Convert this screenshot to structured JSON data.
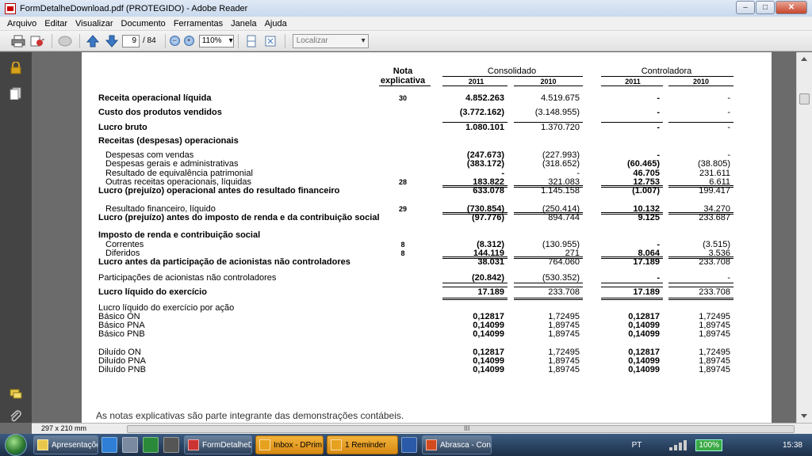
{
  "window": {
    "title": "FormDetalheDownload.pdf (PROTEGIDO) - Adobe Reader",
    "controls": [
      "–",
      "□",
      "✕"
    ]
  },
  "menu": [
    "Arquivo",
    "Editar",
    "Visualizar",
    "Documento",
    "Ferramentas",
    "Janela",
    "Ajuda"
  ],
  "toolbar": {
    "page_current": "9",
    "page_total": "/ 84",
    "zoom": "110%",
    "find_placeholder": "Localizar"
  },
  "statement": {
    "header": {
      "nota_line1": "Nota",
      "nota_line2": "explicativa",
      "consolidado": "Consolidado",
      "controladora": "Controladora",
      "years": [
        "2011",
        "2010",
        "2011",
        "2010"
      ]
    },
    "rows": [
      {
        "label": "Receita operacional líquida",
        "note": "30",
        "c2011": "4.852.263",
        "c2010": "4.519.675",
        "p2011": "-",
        "p2010": "-"
      },
      {
        "label": "Custo dos produtos vendidos",
        "note": "",
        "c2011": "(3.772.162)",
        "c2010": "(3.148.955)",
        "p2011": "-",
        "p2010": "-"
      },
      {
        "label": "Lucro bruto",
        "note": "",
        "c2011": "1.080.101",
        "c2010": "1.370.720",
        "p2011": "-",
        "p2010": "-"
      },
      {
        "label": "Receitas (despesas) operacionais",
        "note": "",
        "c2011": "",
        "c2010": "",
        "p2011": "",
        "p2010": ""
      },
      {
        "label": "Despesas com vendas",
        "note": "",
        "c2011": "(247.673)",
        "c2010": "(227.993)",
        "p2011": "-",
        "p2010": "-"
      },
      {
        "label": "Despesas gerais e administrativas",
        "note": "",
        "c2011": "(383.172)",
        "c2010": "(318.652)",
        "p2011": "(60.465)",
        "p2010": "(38.805)"
      },
      {
        "label": "Resultado de equivalência patrimonial",
        "note": "",
        "c2011": "-",
        "c2010": "-",
        "p2011": "46.705",
        "p2010": "231.611"
      },
      {
        "label": "Outras receitas operacionais, líquidas",
        "note": "28",
        "c2011": "183.822",
        "c2010": "321.083",
        "p2011": "12.753",
        "p2010": "6.611"
      },
      {
        "label": "Lucro (prejuízo) operacional antes do resultado financeiro",
        "note": "",
        "c2011": "633.078",
        "c2010": "1.145.158",
        "p2011": "(1.007)",
        "p2010": "199.417"
      },
      {
        "label": "Resultado financeiro, líquido",
        "note": "29",
        "c2011": "(730.854)",
        "c2010": "(250.414)",
        "p2011": "10.132",
        "p2010": "34.270"
      },
      {
        "label": "Lucro (prejuízo) antes do imposto de renda  e da contribuição social",
        "note": "",
        "c2011": "(97.776)",
        "c2010": "894.744",
        "p2011": "9.125",
        "p2010": "233.687"
      },
      {
        "label": "Imposto de renda e contribuição social",
        "note": "",
        "c2011": "",
        "c2010": "",
        "p2011": "",
        "p2010": ""
      },
      {
        "label": "Correntes",
        "note": "8",
        "c2011": "(8.312)",
        "c2010": "(130.955)",
        "p2011": "-",
        "p2010": "(3.515)"
      },
      {
        "label": "Diferidos",
        "note": "8",
        "c2011": "144.119",
        "c2010": "271",
        "p2011": "8.064",
        "p2010": "3.536"
      },
      {
        "label": "Lucro antes da participação de acionistas não controladores",
        "note": "",
        "c2011": "38.031",
        "c2010": "764.060",
        "p2011": "17.189",
        "p2010": "233.708"
      },
      {
        "label": "Participações de acionistas não controladores",
        "note": "",
        "c2011": "(20.842)",
        "c2010": "(530.352)",
        "p2011": "-",
        "p2010": "-"
      },
      {
        "label": "Lucro líquido do exercício",
        "note": "",
        "c2011": "17.189",
        "c2010": "233.708",
        "p2011": "17.189",
        "p2010": "233.708"
      },
      {
        "label": "Lucro líquido do exercício por ação",
        "note": "",
        "c2011": "",
        "c2010": "",
        "p2011": "",
        "p2010": ""
      },
      {
        "label": "Básico ON",
        "note": "",
        "c2011": "0,12817",
        "c2010": "1,72495",
        "p2011": "0,12817",
        "p2010": "1,72495"
      },
      {
        "label": "Básico PNA",
        "note": "",
        "c2011": "0,14099",
        "c2010": "1,89745",
        "p2011": "0,14099",
        "p2010": "1,89745"
      },
      {
        "label": "Básico PNB",
        "note": "",
        "c2011": "0,14099",
        "c2010": "1,89745",
        "p2011": "0,14099",
        "p2010": "1,89745"
      },
      {
        "label": "Diluído ON",
        "note": "",
        "c2011": "0,12817",
        "c2010": "1,72495",
        "p2011": "0,12817",
        "p2010": "1,72495"
      },
      {
        "label": "Diluído PNA",
        "note": "",
        "c2011": "0,14099",
        "c2010": "1,89745",
        "p2011": "0,14099",
        "p2010": "1,89745"
      },
      {
        "label": "Diluído PNB",
        "note": "",
        "c2011": "0,14099",
        "c2010": "1,89745",
        "p2011": "0,14099",
        "p2010": "1,89745"
      }
    ],
    "footnote": "As notas explicativas são parte integrante das demonstrações contábeis."
  },
  "status": {
    "page_size": "297 x 210 mm",
    "hscroll_mark": "III"
  },
  "taskbar": {
    "items": [
      "Apresentações",
      "FormDetalheD...",
      "Inbox - DPrim...",
      "1 Reminder",
      "Abrasca - Con..."
    ],
    "lang": "PT",
    "battery": "100%",
    "clock": "15:38"
  },
  "colors": {
    "titlebar": "#c9d9ee",
    "close_button": "#c7462c",
    "taskbar": "#1d2f47",
    "outlook_button": "#f2b33c",
    "battery": "#3aa845"
  }
}
